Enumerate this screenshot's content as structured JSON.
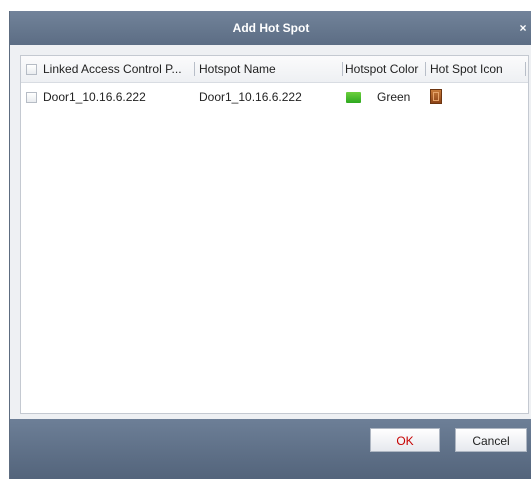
{
  "dialog": {
    "title": "Add Hot Spot",
    "close_glyph": "×"
  },
  "table": {
    "columns": [
      "Linked Access Control P...",
      "Hotspot Name",
      "Hotspot Color",
      "Hot Spot Icon"
    ],
    "rows": [
      {
        "linked_access_control_point": "Door1_10.16.6.222",
        "hotspot_name": "Door1_10.16.6.222",
        "hotspot_color": "Green",
        "hotspot_color_hex": "#3dbb2a",
        "hotspot_icon": "door-icon"
      }
    ]
  },
  "buttons": {
    "ok": "OK",
    "cancel": "Cancel"
  }
}
